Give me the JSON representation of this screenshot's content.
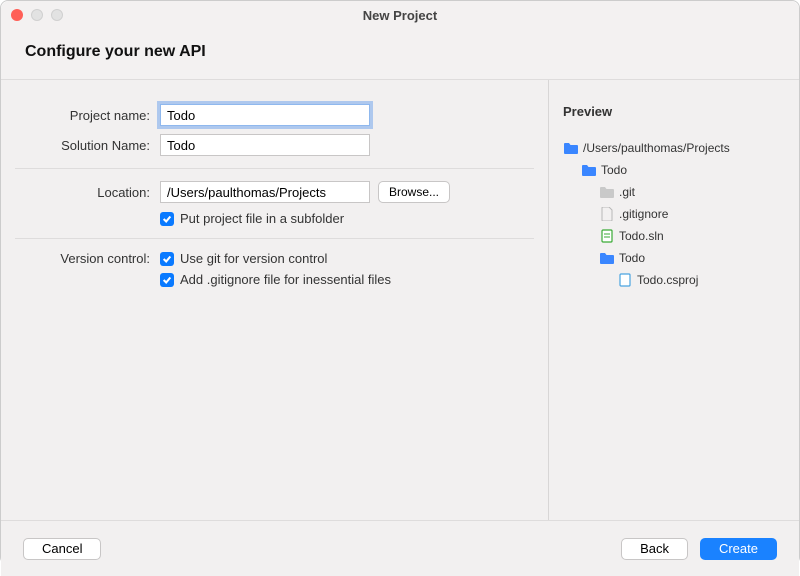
{
  "window": {
    "title": "New Project"
  },
  "header": {
    "heading": "Configure your new API"
  },
  "form": {
    "projectNameLabel": "Project name:",
    "projectNameValue": "Todo",
    "solutionNameLabel": "Solution Name:",
    "solutionNameValue": "Todo",
    "locationLabel": "Location:",
    "locationValue": "/Users/paulthomas/Projects",
    "browseLabel": "Browse...",
    "subfolderLabel": "Put project file in a subfolder",
    "versionControlLabel": "Version control:",
    "useGitLabel": "Use git for version control",
    "addGitignoreLabel": "Add .gitignore file for inessential files"
  },
  "preview": {
    "heading": "Preview",
    "tree": {
      "root": "/Users/paulthomas/Projects",
      "lvl1_folder": "Todo",
      "git": ".git",
      "gitignore": ".gitignore",
      "sln": "Todo.sln",
      "lvl2_folder": "Todo",
      "csproj": "Todo.csproj"
    }
  },
  "footer": {
    "cancel": "Cancel",
    "back": "Back",
    "create": "Create"
  },
  "colors": {
    "accent": "#1a82ff"
  }
}
